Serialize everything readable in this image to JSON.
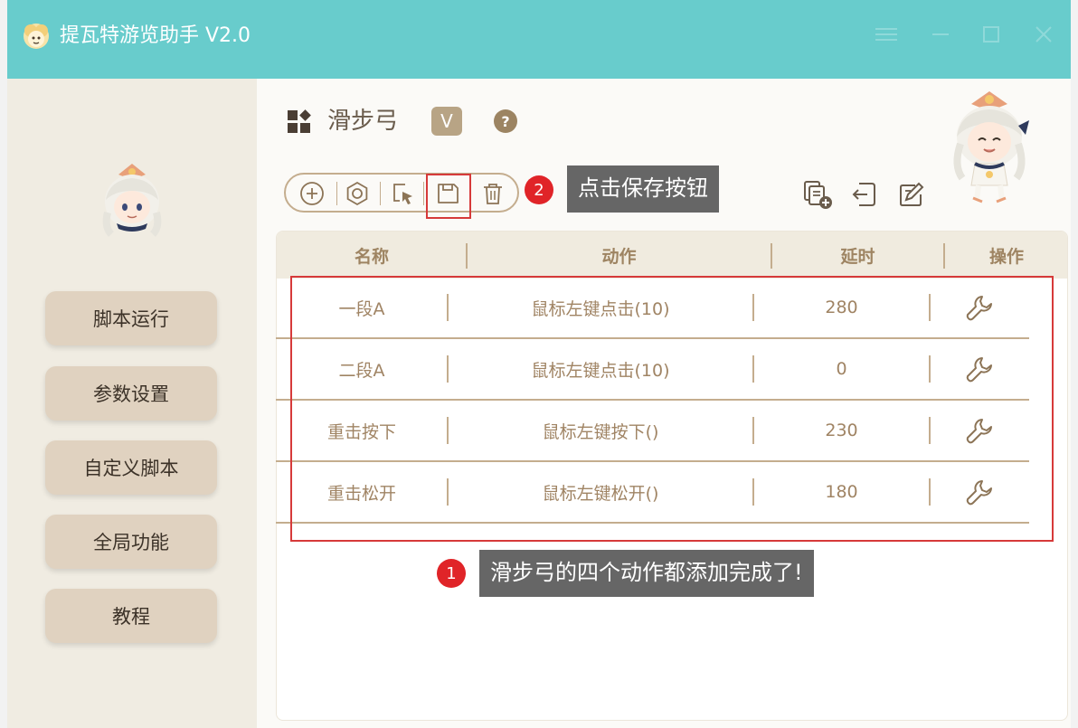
{
  "window": {
    "title": "提瓦特游览助手 V2.0"
  },
  "sidebar": {
    "items": [
      {
        "label": "脚本运行"
      },
      {
        "label": "参数设置"
      },
      {
        "label": "自定义脚本"
      },
      {
        "label": "全局功能"
      },
      {
        "label": "教程"
      }
    ]
  },
  "main": {
    "title": "滑步弓",
    "version_badge": "V",
    "help_label": "?"
  },
  "annotations": {
    "save_step_num": "2",
    "save_step_text": "点击保存按钮",
    "done_step_num": "1",
    "done_step_text": "滑步弓的四个动作都添加完成了!"
  },
  "table": {
    "headers": [
      "名称",
      "动作",
      "延时",
      "操作"
    ],
    "rows": [
      {
        "name": "一段A",
        "action": "鼠标左键点击(10)",
        "delay": "280"
      },
      {
        "name": "二段A",
        "action": "鼠标左键点击(10)",
        "delay": "0"
      },
      {
        "name": "重击按下",
        "action": "鼠标左键按下()",
        "delay": "230"
      },
      {
        "name": "重击松开",
        "action": "鼠标左键松开()",
        "delay": "180"
      }
    ]
  },
  "colors": {
    "titlebar": "#68cccc",
    "sidebar": "#f0ece2",
    "nav_button": "#e0d2c0",
    "accent": "#c4ad8e",
    "highlight": "#d63a3a"
  },
  "icons": {
    "toolbar": [
      "add-circle-icon",
      "settings-hexagon-icon",
      "cursor-select-icon",
      "save-icon",
      "trash-icon"
    ],
    "right_tools": [
      "copy-add-icon",
      "import-icon",
      "edit-export-icon"
    ],
    "row_action": "wrench-icon"
  }
}
